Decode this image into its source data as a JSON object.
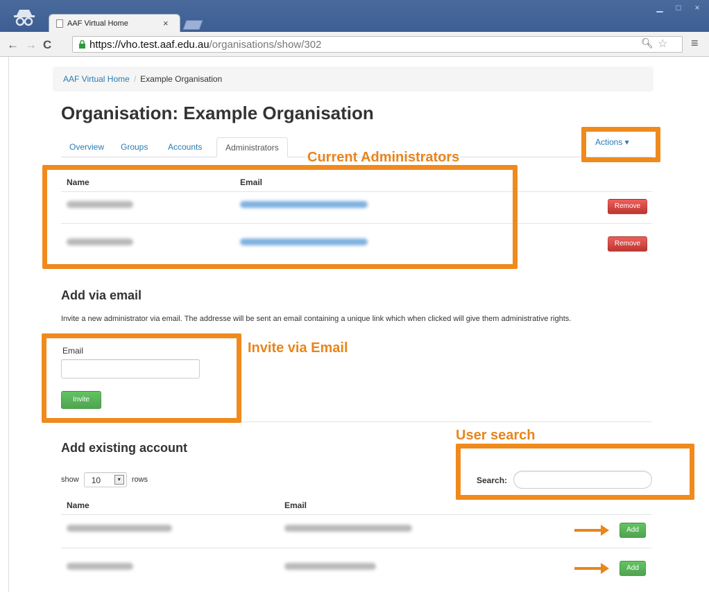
{
  "browser": {
    "tab_title": "AAF Virtual Home",
    "tab_close": "×",
    "url_host": "https://vho.test.aaf.edu.au",
    "url_path": "/organisations/show/302"
  },
  "breadcrumb": {
    "home": "AAF Virtual Home",
    "separator": "/",
    "current": "Example Organisation"
  },
  "page_title": "Organisation: Example Organisation",
  "tabs": [
    "Overview",
    "Groups",
    "Accounts",
    "Administrators"
  ],
  "actions_label": "Actions ▾",
  "administrators": {
    "columns": [
      "Name",
      "Email"
    ],
    "remove_label": "Remove"
  },
  "add_via_email": {
    "heading": "Add via email",
    "description": "Invite a new administrator via email. The addresse will be sent an email containing a unique link which when clicked will give them administrative rights.",
    "email_label": "Email",
    "invite_label": "Invite"
  },
  "add_existing": {
    "heading": "Add existing account",
    "show_label": "show",
    "rows_value": "10",
    "rows_label": "rows",
    "search_label": "Search:",
    "columns": [
      "Name",
      "Email"
    ],
    "add_label": "Add"
  },
  "annotations": {
    "current_admins": "Current Administrators",
    "invite_email": "Invite via Email",
    "user_search": "User search"
  },
  "colors": {
    "annotation": "#f08a1c",
    "link": "#2a7ab0"
  }
}
